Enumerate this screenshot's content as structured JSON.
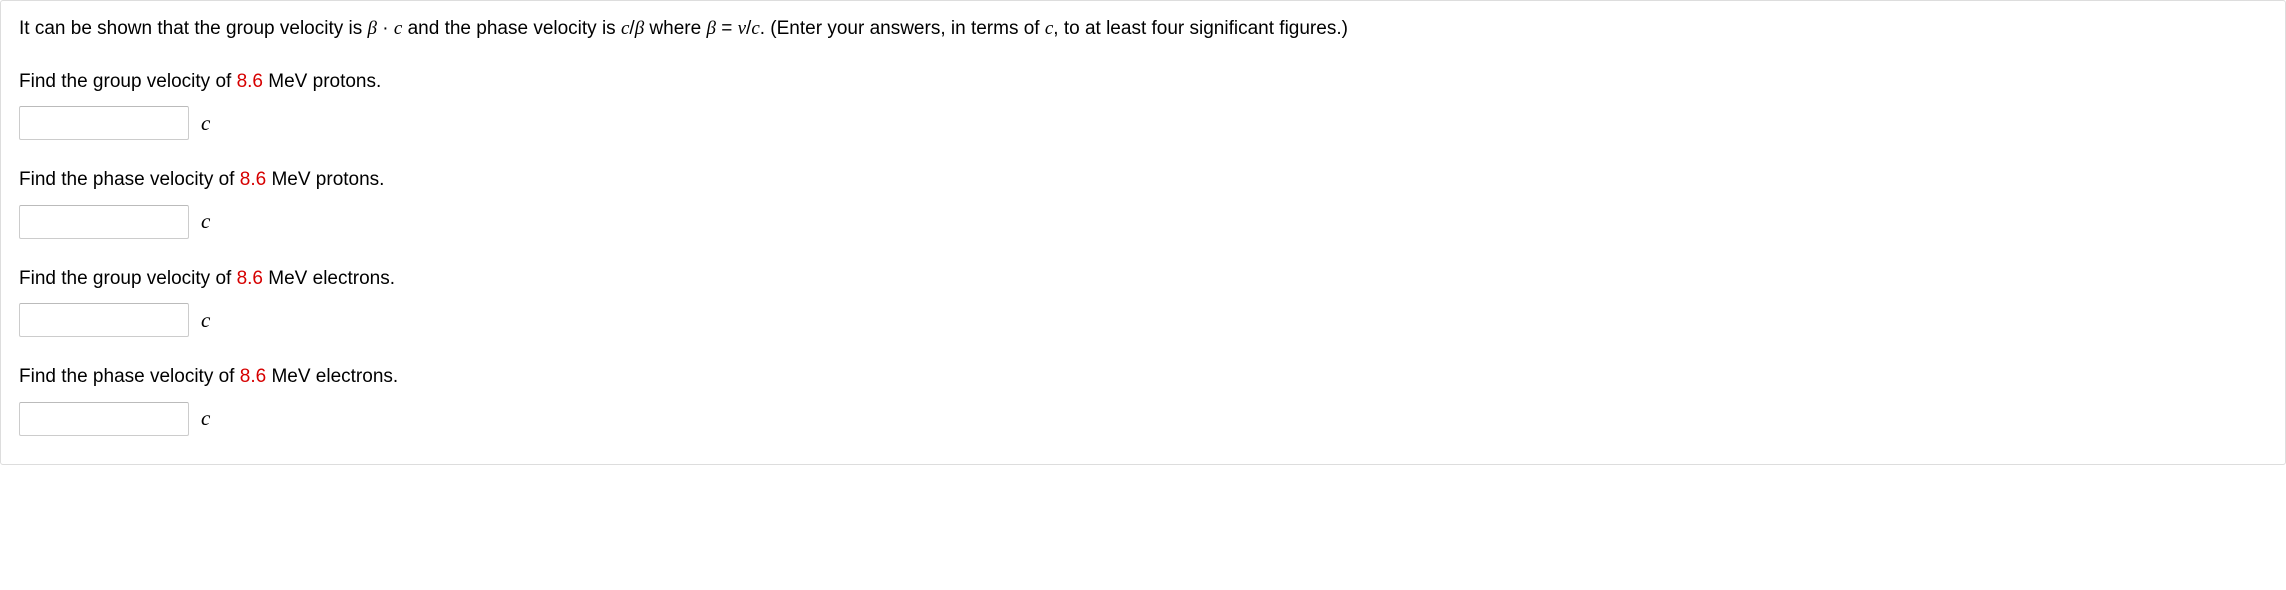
{
  "intro": {
    "t1": "It can be shown that the group velocity is ",
    "beta": "β",
    "t2": " · ",
    "c1": "c",
    "t3": " and the phase velocity is ",
    "c2": "c",
    "t4": "/",
    "beta2": "β",
    "t5": " where ",
    "beta3": "β",
    "t6": " = ",
    "v": "v",
    "t7": "/",
    "c3": "c",
    "t8": ". (Enter your answers, in terms of ",
    "c4": "c",
    "t9": ", to at least four significant figures.)"
  },
  "questions": [
    {
      "pre": "Find the group velocity of ",
      "value": "8.6",
      "post": " MeV protons.",
      "unit": "c"
    },
    {
      "pre": "Find the phase velocity of ",
      "value": "8.6",
      "post": " MeV protons.",
      "unit": "c"
    },
    {
      "pre": "Find the group velocity of ",
      "value": "8.6",
      "post": " MeV electrons.",
      "unit": "c"
    },
    {
      "pre": "Find the phase velocity of ",
      "value": "8.6",
      "post": " MeV electrons.",
      "unit": "c"
    }
  ]
}
